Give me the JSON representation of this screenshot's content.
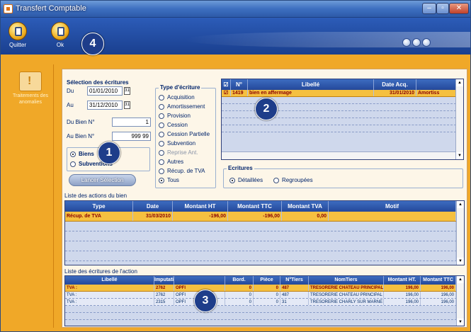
{
  "window": {
    "title": "Transfert Comptable"
  },
  "toolbar": {
    "quit_label": "Quitter",
    "ok_label": "Ok"
  },
  "callouts": [
    "1",
    "2",
    "3",
    "4"
  ],
  "sidebar": {
    "label": "Traitements des anomalies"
  },
  "selection": {
    "title": "Sélection des écritures",
    "du_label": "Du",
    "du_value": "01/01/2010",
    "au_label": "Au",
    "au_value": "31/12/2010",
    "du_bien_label": "Du Bien N°",
    "du_bien_value": "1",
    "au_bien_label": "Au Bien N°",
    "au_bien_value": "999 99",
    "biens_label": "Biens",
    "subv_label": "Subventions",
    "lancer_label": "Lancer Sélection"
  },
  "type_ecriture": {
    "title": "Type d'écriture",
    "options": [
      "Acquisition",
      "Amortissement",
      "Provision",
      "Cession",
      "Cession Partielle",
      "Subvention",
      "Reprise Ant.",
      "Autres",
      "Récup. de TVA",
      "Tous"
    ]
  },
  "biens_grid": {
    "headers": [
      "",
      "N°",
      "Libellé",
      "Date Acq.",
      ""
    ],
    "rows": [
      {
        "num": "1419",
        "libelle": "bien en affermage",
        "date": "31/01/2010",
        "type": "Amortiss"
      }
    ]
  },
  "ecritures": {
    "title": "Ecritures",
    "detail": "Détaillées",
    "group": "Regroupées"
  },
  "actions": {
    "title": "Liste des actions du bien",
    "headers": [
      "Type",
      "Date",
      "Montant HT",
      "Montant TTC",
      "Montant TVA",
      "Motif"
    ],
    "rows": [
      {
        "type": "Récup. de TVA",
        "date": "31/03/2010",
        "ht": "-196,00",
        "ttc": "-196,00",
        "tva": "0,00",
        "motif": ""
      }
    ]
  },
  "lignes": {
    "title": "Liste des écritures de l'action",
    "headers": [
      "Libellé",
      "Imputation",
      "",
      "Bord.",
      "Pièce",
      "N°Tiers",
      "NomTiers",
      "Montant HT.",
      "Montant TTC"
    ],
    "rows": [
      {
        "lib": "TVA :",
        "imp": "2762",
        "code": "OPFI",
        "bord": "0",
        "piece": "0",
        "tiers": "487",
        "nom": "TRESORERIE CHATEAU PRINCIPAL",
        "ht": "196,00",
        "ttc": "196,00"
      },
      {
        "lib": "TVA :",
        "imp": "2762",
        "code": "OPFI",
        "bord": "0",
        "piece": "0",
        "tiers": "487",
        "nom": "TRESORERIE CHATEAU PRINCIPAL",
        "ht": "196,00",
        "ttc": "196,00"
      },
      {
        "lib": "TVA :",
        "imp": "2315",
        "code": "OPFI",
        "bord": "0",
        "piece": "0",
        "tiers": "31",
        "nom": "TRESORERIE CHARLY SUR MARNE",
        "ht": "196,00",
        "ttc": "196,00"
      }
    ]
  }
}
